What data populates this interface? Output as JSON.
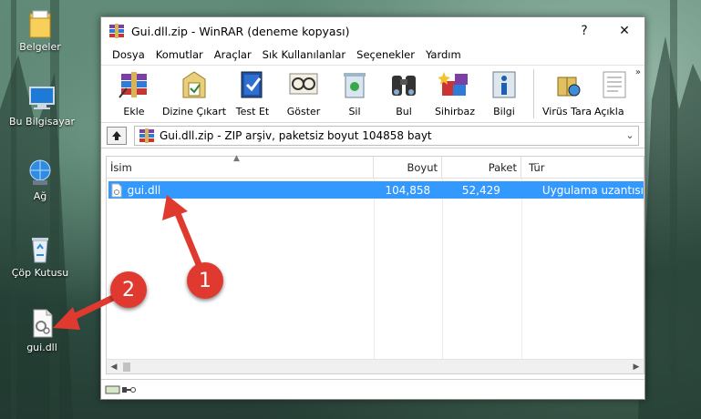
{
  "desktop": {
    "icons": [
      {
        "label": "Belgeler",
        "icon": "folder-icon"
      },
      {
        "label": "Bu Bilgisayar",
        "icon": "computer-icon"
      },
      {
        "label": "Ağ",
        "icon": "network-icon"
      },
      {
        "label": "Çöp Kutusu",
        "icon": "recycle-bin-icon"
      },
      {
        "label": "gui.dll",
        "icon": "dll-file-icon"
      }
    ]
  },
  "window": {
    "title": "Gui.dll.zip - WinRAR (deneme kopyası)",
    "help_label": "?",
    "close_label": "✕",
    "menu": [
      "Dosya",
      "Komutlar",
      "Araçlar",
      "Sık Kullanılanlar",
      "Seçenekler",
      "Yardım"
    ],
    "toolbar": [
      {
        "label": "Ekle",
        "icon": "add-archive-icon"
      },
      {
        "label": "Dizine Çıkart",
        "icon": "extract-icon"
      },
      {
        "label": "Test Et",
        "icon": "test-icon"
      },
      {
        "label": "Göster",
        "icon": "view-icon"
      },
      {
        "label": "Sil",
        "icon": "delete-icon"
      },
      {
        "label": "Bul",
        "icon": "find-icon"
      },
      {
        "label": "Sihirbaz",
        "icon": "wizard-icon"
      },
      {
        "label": "Bilgi",
        "icon": "info-icon"
      },
      {
        "label": "Virüs Tara",
        "icon": "virus-scan-icon"
      },
      {
        "label": "Açıkla",
        "icon": "comment-icon"
      }
    ],
    "toolbar_more": "»",
    "address": "Gui.dll.zip - ZIP arşiv, paketsiz boyut 104858 bayt",
    "columns": [
      "İsim",
      "Boyut",
      "Paket",
      "Tür"
    ],
    "files": [
      {
        "name": "gui.dll",
        "size": "104,858",
        "packed": "52,429",
        "type": "Uygulama uzantısı"
      }
    ],
    "accent": "#3399ff"
  },
  "annotations": [
    "1",
    "2"
  ]
}
